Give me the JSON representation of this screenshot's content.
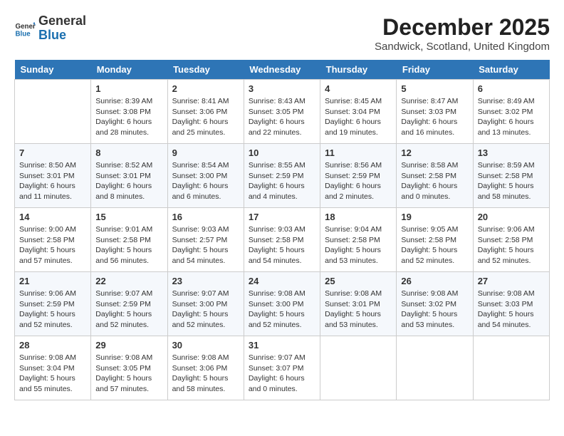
{
  "header": {
    "logo_general": "General",
    "logo_blue": "Blue",
    "month": "December 2025",
    "location": "Sandwick, Scotland, United Kingdom"
  },
  "days_of_week": [
    "Sunday",
    "Monday",
    "Tuesday",
    "Wednesday",
    "Thursday",
    "Friday",
    "Saturday"
  ],
  "weeks": [
    [
      {
        "day": "",
        "info": ""
      },
      {
        "day": "1",
        "info": "Sunrise: 8:39 AM\nSunset: 3:08 PM\nDaylight: 6 hours\nand 28 minutes."
      },
      {
        "day": "2",
        "info": "Sunrise: 8:41 AM\nSunset: 3:06 PM\nDaylight: 6 hours\nand 25 minutes."
      },
      {
        "day": "3",
        "info": "Sunrise: 8:43 AM\nSunset: 3:05 PM\nDaylight: 6 hours\nand 22 minutes."
      },
      {
        "day": "4",
        "info": "Sunrise: 8:45 AM\nSunset: 3:04 PM\nDaylight: 6 hours\nand 19 minutes."
      },
      {
        "day": "5",
        "info": "Sunrise: 8:47 AM\nSunset: 3:03 PM\nDaylight: 6 hours\nand 16 minutes."
      },
      {
        "day": "6",
        "info": "Sunrise: 8:49 AM\nSunset: 3:02 PM\nDaylight: 6 hours\nand 13 minutes."
      }
    ],
    [
      {
        "day": "7",
        "info": "Sunrise: 8:50 AM\nSunset: 3:01 PM\nDaylight: 6 hours\nand 11 minutes."
      },
      {
        "day": "8",
        "info": "Sunrise: 8:52 AM\nSunset: 3:01 PM\nDaylight: 6 hours\nand 8 minutes."
      },
      {
        "day": "9",
        "info": "Sunrise: 8:54 AM\nSunset: 3:00 PM\nDaylight: 6 hours\nand 6 minutes."
      },
      {
        "day": "10",
        "info": "Sunrise: 8:55 AM\nSunset: 2:59 PM\nDaylight: 6 hours\nand 4 minutes."
      },
      {
        "day": "11",
        "info": "Sunrise: 8:56 AM\nSunset: 2:59 PM\nDaylight: 6 hours\nand 2 minutes."
      },
      {
        "day": "12",
        "info": "Sunrise: 8:58 AM\nSunset: 2:58 PM\nDaylight: 6 hours\nand 0 minutes."
      },
      {
        "day": "13",
        "info": "Sunrise: 8:59 AM\nSunset: 2:58 PM\nDaylight: 5 hours\nand 58 minutes."
      }
    ],
    [
      {
        "day": "14",
        "info": "Sunrise: 9:00 AM\nSunset: 2:58 PM\nDaylight: 5 hours\nand 57 minutes."
      },
      {
        "day": "15",
        "info": "Sunrise: 9:01 AM\nSunset: 2:58 PM\nDaylight: 5 hours\nand 56 minutes."
      },
      {
        "day": "16",
        "info": "Sunrise: 9:03 AM\nSunset: 2:57 PM\nDaylight: 5 hours\nand 54 minutes."
      },
      {
        "day": "17",
        "info": "Sunrise: 9:03 AM\nSunset: 2:58 PM\nDaylight: 5 hours\nand 54 minutes."
      },
      {
        "day": "18",
        "info": "Sunrise: 9:04 AM\nSunset: 2:58 PM\nDaylight: 5 hours\nand 53 minutes."
      },
      {
        "day": "19",
        "info": "Sunrise: 9:05 AM\nSunset: 2:58 PM\nDaylight: 5 hours\nand 52 minutes."
      },
      {
        "day": "20",
        "info": "Sunrise: 9:06 AM\nSunset: 2:58 PM\nDaylight: 5 hours\nand 52 minutes."
      }
    ],
    [
      {
        "day": "21",
        "info": "Sunrise: 9:06 AM\nSunset: 2:59 PM\nDaylight: 5 hours\nand 52 minutes."
      },
      {
        "day": "22",
        "info": "Sunrise: 9:07 AM\nSunset: 2:59 PM\nDaylight: 5 hours\nand 52 minutes."
      },
      {
        "day": "23",
        "info": "Sunrise: 9:07 AM\nSunset: 3:00 PM\nDaylight: 5 hours\nand 52 minutes."
      },
      {
        "day": "24",
        "info": "Sunrise: 9:08 AM\nSunset: 3:00 PM\nDaylight: 5 hours\nand 52 minutes."
      },
      {
        "day": "25",
        "info": "Sunrise: 9:08 AM\nSunset: 3:01 PM\nDaylight: 5 hours\nand 53 minutes."
      },
      {
        "day": "26",
        "info": "Sunrise: 9:08 AM\nSunset: 3:02 PM\nDaylight: 5 hours\nand 53 minutes."
      },
      {
        "day": "27",
        "info": "Sunrise: 9:08 AM\nSunset: 3:03 PM\nDaylight: 5 hours\nand 54 minutes."
      }
    ],
    [
      {
        "day": "28",
        "info": "Sunrise: 9:08 AM\nSunset: 3:04 PM\nDaylight: 5 hours\nand 55 minutes."
      },
      {
        "day": "29",
        "info": "Sunrise: 9:08 AM\nSunset: 3:05 PM\nDaylight: 5 hours\nand 57 minutes."
      },
      {
        "day": "30",
        "info": "Sunrise: 9:08 AM\nSunset: 3:06 PM\nDaylight: 5 hours\nand 58 minutes."
      },
      {
        "day": "31",
        "info": "Sunrise: 9:07 AM\nSunset: 3:07 PM\nDaylight: 6 hours\nand 0 minutes."
      },
      {
        "day": "",
        "info": ""
      },
      {
        "day": "",
        "info": ""
      },
      {
        "day": "",
        "info": ""
      }
    ]
  ]
}
